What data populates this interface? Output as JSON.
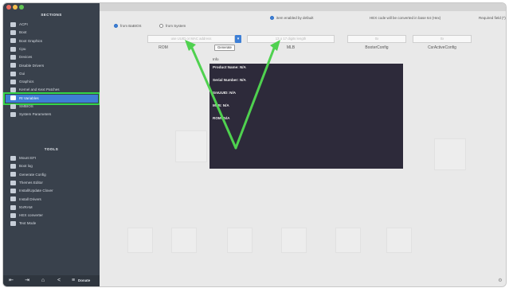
{
  "window": {
    "controls": [
      {
        "name": "close",
        "color": "#ed6a5e"
      },
      {
        "name": "minimize",
        "color": "#f5bf4f"
      },
      {
        "name": "zoom",
        "color": "#61c554"
      }
    ]
  },
  "sidebar": {
    "sections_heading": "SECTIONS",
    "sections": [
      {
        "label": "ACPI",
        "icon": "list-icon"
      },
      {
        "label": "Boot",
        "icon": "list-icon"
      },
      {
        "label": "Boot Graphics",
        "icon": "list-icon"
      },
      {
        "label": "Cpu",
        "icon": "list-icon"
      },
      {
        "label": "Devices",
        "icon": "list-icon"
      },
      {
        "label": "Disable Drivers",
        "icon": "list-icon"
      },
      {
        "label": "Gui",
        "icon": "list-icon"
      },
      {
        "label": "Graphics",
        "icon": "list-icon"
      },
      {
        "label": "Kernel and Kext Patches",
        "icon": "list-icon"
      },
      {
        "label": "Rt Variables",
        "icon": "list-icon",
        "active": true
      },
      {
        "label": "SMBIOS",
        "icon": "list-icon"
      },
      {
        "label": "System Parameters",
        "icon": "list-icon"
      }
    ],
    "tools_heading": "TOOLS",
    "tools": [
      {
        "label": "Mount EFI",
        "icon": "disk-icon"
      },
      {
        "label": "Boot log",
        "icon": "log-icon"
      },
      {
        "label": "Generate Config",
        "icon": "magic-wand-icon"
      },
      {
        "label": "Themes Editor",
        "icon": "palette-icon"
      },
      {
        "label": "Install/Update Clover",
        "icon": "download-icon"
      },
      {
        "label": "Install Drivers",
        "icon": "wrench-icon"
      },
      {
        "label": "NVRAM",
        "icon": "chip-icon"
      },
      {
        "label": "HEX converter",
        "icon": "refresh-icon"
      },
      {
        "label": "Text Mode",
        "icon": "list-icon"
      }
    ],
    "bottom": {
      "icons": [
        "import-icon",
        "export-icon",
        "home-icon",
        "share-icon"
      ],
      "donate_label": "Donate",
      "donate_icon": "coin-icon"
    }
  },
  "main": {
    "source_options": [
      {
        "label": "from BaBIOS",
        "selected": true
      },
      {
        "label": "from System",
        "selected": false
      }
    ],
    "default_note": "item enabled by default",
    "hex_note": "HEX code will be converted in base 64 (Hex)",
    "required_note": "Required field (*)",
    "rom_placeholder": "use UUID or MAC address",
    "generate_label": "Generate",
    "mlb_placeholder": "13 o 17 digits length",
    "booter_placeholder": "0x",
    "csr_placeholder": "0x",
    "columns": {
      "rom": "ROM",
      "mlb": "MLB",
      "booter": "BooterConfig",
      "csr": "CsrActiveConfig"
    },
    "info_panel": {
      "heading": "Info",
      "lines": [
        "Product Name: N/A",
        "Serial Number: N/A",
        "SmUUID: N/A",
        "MLB: N/A",
        "ROM: N/A"
      ]
    }
  },
  "annotations": {
    "highlight_color": "#33d64a",
    "arrow_color": "#4fd14f"
  }
}
